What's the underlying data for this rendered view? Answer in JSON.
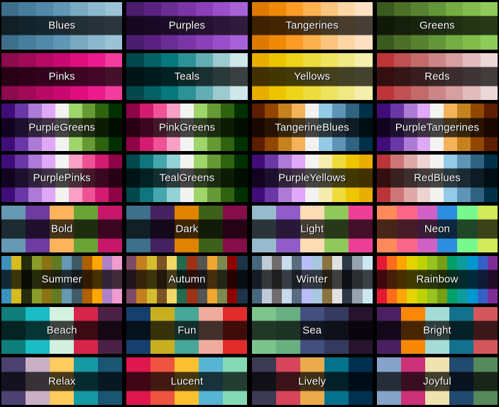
{
  "page": {
    "background": "#000000",
    "label_text_color": "#ffffff",
    "label_bar_overlay": "rgba(0,0,0,0.72)",
    "columns": 4,
    "rows": 8
  },
  "palettes": [
    {
      "name": "Blues",
      "kind": "sequential",
      "colors": [
        "#3d6f8a",
        "#477e9b",
        "#5189aa",
        "#6097b5",
        "#7aa9c2",
        "#8cb8ce",
        "#9cc2d6"
      ]
    },
    {
      "name": "Purples",
      "kind": "sequential",
      "colors": [
        "#4b1d6e",
        "#5b2182",
        "#6a2d93",
        "#7b35a6",
        "#8b3fb8",
        "#9a4ec9",
        "#a862d8"
      ]
    },
    {
      "name": "Tangerines",
      "kind": "sequential",
      "colors": [
        "#dd7b00",
        "#ef8a05",
        "#fa9c26",
        "#fbb14f",
        "#fcc57f",
        "#fdd6a6",
        "#fee1c3"
      ]
    },
    {
      "name": "Greens",
      "kind": "sequential",
      "colors": [
        "#3a5a1e",
        "#4c7028",
        "#578331",
        "#639639",
        "#74ad42",
        "#82bd4c",
        "#8ecb5b"
      ]
    },
    {
      "name": "Pinks",
      "kind": "sequential",
      "colors": [
        "#8d0a4e",
        "#a20a58",
        "#b60a64",
        "#c80a70",
        "#de0f7d",
        "#ec1b8b",
        "#f23d9c"
      ]
    },
    {
      "name": "Teals",
      "kind": "sequential",
      "colors": [
        "#03484c",
        "#046165",
        "#07787e",
        "#2d9298",
        "#62aeb3",
        "#9ccbcf",
        "#cfe7ea"
      ]
    },
    {
      "name": "Yellows",
      "kind": "sequential",
      "colors": [
        "#e8ae00",
        "#edc500",
        "#eed51a",
        "#eedc3f",
        "#efe460",
        "#f0e884",
        "#f5efae"
      ]
    },
    {
      "name": "Reds",
      "kind": "sequential",
      "colors": [
        "#bc3539",
        "#bf5053",
        "#c46a6b",
        "#cd8688",
        "#d69fa0",
        "#e2bcbd",
        "#ecd8d8"
      ]
    },
    {
      "name": "PurpleGreens",
      "kind": "diverging",
      "colors": [
        "#400d78",
        "#6a37a6",
        "#ad7ad6",
        "#e0a8f8",
        "#f2f3f1",
        "#9ed66b",
        "#679a34",
        "#2f6310",
        "#003000"
      ]
    },
    {
      "name": "PinkGreens",
      "kind": "diverging",
      "colors": [
        "#8e0447",
        "#d31b70",
        "#f05395",
        "#f9a0c6",
        "#f3f3f1",
        "#9ed66b",
        "#679a34",
        "#2f6310",
        "#003000"
      ]
    },
    {
      "name": "TangerineBlues",
      "kind": "diverging",
      "colors": [
        "#5c1d00",
        "#924600",
        "#c6821e",
        "#f4b35a",
        "#f2f3f1",
        "#93cbe6",
        "#5e94b5",
        "#2f6380",
        "#003047"
      ]
    },
    {
      "name": "PurpleTangerines",
      "kind": "diverging",
      "colors": [
        "#400d78",
        "#6a37a6",
        "#ad7ad6",
        "#e0a8f8",
        "#f3f3f1",
        "#f4b35a",
        "#c6821e",
        "#924600",
        "#5c1d00"
      ]
    },
    {
      "name": "PurplePinks",
      "kind": "diverging",
      "colors": [
        "#400d78",
        "#6a37a6",
        "#ad7ad6",
        "#e0a8f8",
        "#f3f3f1",
        "#f9a0c6",
        "#f05395",
        "#d31b70",
        "#8e0447"
      ]
    },
    {
      "name": "TealGreens",
      "kind": "diverging",
      "colors": [
        "#03484c",
        "#0e767c",
        "#45a7ac",
        "#93d2d5",
        "#f3f3f1",
        "#9ed66b",
        "#679a34",
        "#2f6310",
        "#003000"
      ]
    },
    {
      "name": "PurpleYellows",
      "kind": "diverging",
      "colors": [
        "#400d78",
        "#6a37a6",
        "#ad7ad6",
        "#e0a8f8",
        "#f3f3f1",
        "#f5edb0",
        "#eedc3f",
        "#edc500",
        "#e8ae00"
      ]
    },
    {
      "name": "RedBlues",
      "kind": "diverging",
      "colors": [
        "#bc3539",
        "#ce7677",
        "#dfa9aa",
        "#efd3d3",
        "#f3f3f1",
        "#93cbe6",
        "#5e94b5",
        "#2f6380",
        "#003047"
      ]
    },
    {
      "name": "Bold",
      "kind": "qualitative",
      "colors": [
        "#6699b3",
        "#6e3ca0",
        "#fbb45c",
        "#6aa436",
        "#c8176b"
      ]
    },
    {
      "name": "Dark",
      "kind": "qualitative",
      "colors": [
        "#3d6f8a",
        "#44225f",
        "#e08300",
        "#3d6119",
        "#850d4a"
      ]
    },
    {
      "name": "Light",
      "kind": "qualitative",
      "colors": [
        "#98bacd",
        "#8f5cc9",
        "#fcdcb4",
        "#90c85c",
        "#ed3f94"
      ]
    },
    {
      "name": "Neon",
      "kind": "qualitative",
      "colors": [
        "#ff8a5c",
        "#fc6688",
        "#d261c6",
        "#2e8ee0",
        "#78f98e",
        "#d2ea5a"
      ]
    },
    {
      "name": "Summer",
      "kind": "qualitative",
      "colors": [
        "#3c92bc",
        "#d6bc20",
        "#252d0d",
        "#8a9c2a",
        "#8a7413",
        "#627b22",
        "#6699b3",
        "#415b66",
        "#b06000",
        "#fca800",
        "#b080c8",
        "#f09cd0"
      ]
    },
    {
      "name": "Autumn",
      "kind": "qualitative",
      "colors": [
        "#7c4a66",
        "#c4801f",
        "#d6bc30",
        "#7c5424",
        "#f2d866",
        "#236a4f",
        "#9e3214",
        "#545452",
        "#f0a631",
        "#7c8a50",
        "#8e0400",
        "#1c3449"
      ]
    },
    {
      "name": "Winter",
      "kind": "qualitative",
      "colors": [
        "#46687e",
        "#bfccd8",
        "#716c6e",
        "#c6dced",
        "#5a6c80",
        "#b8bdfa",
        "#a8c8e0",
        "#8a7340",
        "#e0e2e2",
        "#2d3846",
        "#97a4b0",
        "#cde8f3"
      ]
    },
    {
      "name": "Rainbow",
      "kind": "qualitative",
      "colors": [
        "#e21a34",
        "#fb6c1c",
        "#fea702",
        "#e5d400",
        "#bed200",
        "#96c420",
        "#789e14",
        "#00a06a",
        "#0e9c9c",
        "#0098d0",
        "#3461c6",
        "#7f2d96"
      ]
    },
    {
      "name": "Beach",
      "kind": "qualitative",
      "colors": [
        "#0f7f7b",
        "#19bdc3",
        "#d4f0e0",
        "#d62549",
        "#4a2144"
      ]
    },
    {
      "name": "Fun",
      "kind": "qualitative",
      "colors": [
        "#173f6e",
        "#c7b020",
        "#47a799",
        "#eeab9e",
        "#e22b2b"
      ]
    },
    {
      "name": "Sea",
      "kind": "qualitative",
      "colors": [
        "#7cc48d",
        "#6aaf82",
        "#43507d",
        "#353a5e",
        "#26142c"
      ]
    },
    {
      "name": "Bright",
      "kind": "qualitative",
      "colors": [
        "#4a2160",
        "#f98806",
        "#a5dcd6",
        "#12728e",
        "#d2565c"
      ]
    },
    {
      "name": "Relax",
      "kind": "qualitative",
      "colors": [
        "#4b4272",
        "#c9b0c2",
        "#fdcb5e",
        "#159aa4",
        "#1a5672"
      ]
    },
    {
      "name": "Lucent",
      "kind": "qualitative",
      "colors": [
        "#e0164f",
        "#ef5441",
        "#fbc02f",
        "#58b4d4",
        "#83dab4"
      ]
    },
    {
      "name": "Lively",
      "kind": "qualitative",
      "colors": [
        "#3d3a54",
        "#d6455c",
        "#eaab4c",
        "#04728c",
        "#003050"
      ]
    },
    {
      "name": "Joyful",
      "kind": "qualitative",
      "colors": [
        "#85a3c8",
        "#cc3277",
        "#eee2ae",
        "#22496e",
        "#55895c"
      ]
    }
  ]
}
